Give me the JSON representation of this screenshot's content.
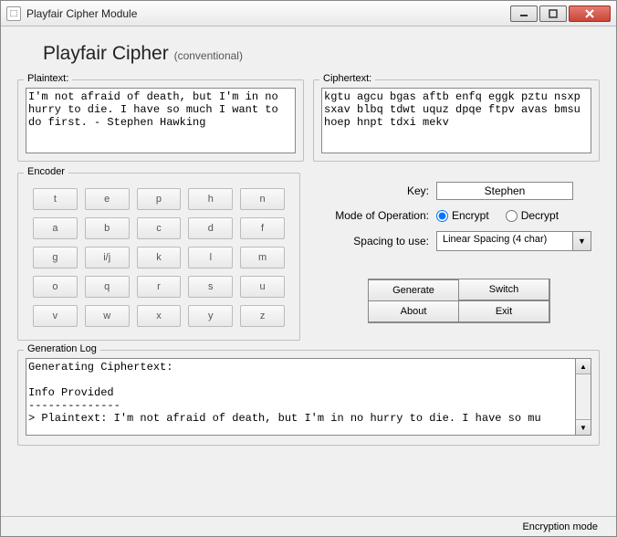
{
  "window": {
    "title": "Playfair Cipher Module"
  },
  "header": {
    "title": "Playfair Cipher",
    "subtitle": "(conventional)"
  },
  "plaintext": {
    "legend": "Plaintext:",
    "value": "I'm not afraid of death, but I'm in no hurry to die. I have so much I want to do first. - Stephen Hawking"
  },
  "ciphertext": {
    "legend": "Ciphertext:",
    "value": "kgtu agcu bgas aftb enfq eggk pztu nsxp sxav blbq tdwt uquz dpqe ftpv avas bmsu hoep hnpt tdxi mekv"
  },
  "encoder": {
    "legend": "Encoder",
    "cells": [
      "t",
      "e",
      "p",
      "h",
      "n",
      "a",
      "b",
      "c",
      "d",
      "f",
      "g",
      "i/j",
      "k",
      "l",
      "m",
      "o",
      "q",
      "r",
      "s",
      "u",
      "v",
      "w",
      "x",
      "y",
      "z"
    ]
  },
  "form": {
    "key_label": "Key:",
    "key_value": "Stephen",
    "mode_label": "Mode of Operation:",
    "mode_options": {
      "encrypt": "Encrypt",
      "decrypt": "Decrypt"
    },
    "mode_selected": "encrypt",
    "spacing_label": "Spacing to use:",
    "spacing_value": "Linear Spacing (4 char)"
  },
  "buttons": {
    "generate": "Generate",
    "switch": "Switch",
    "about": "About",
    "exit": "Exit"
  },
  "log": {
    "legend": "Generation Log",
    "content": "Generating Ciphertext:\n\nInfo Provided\n--------------\n> Plaintext: I'm not afraid of death, but I'm in no hurry to die. I have so mu"
  },
  "status": {
    "text": "Encryption mode"
  }
}
